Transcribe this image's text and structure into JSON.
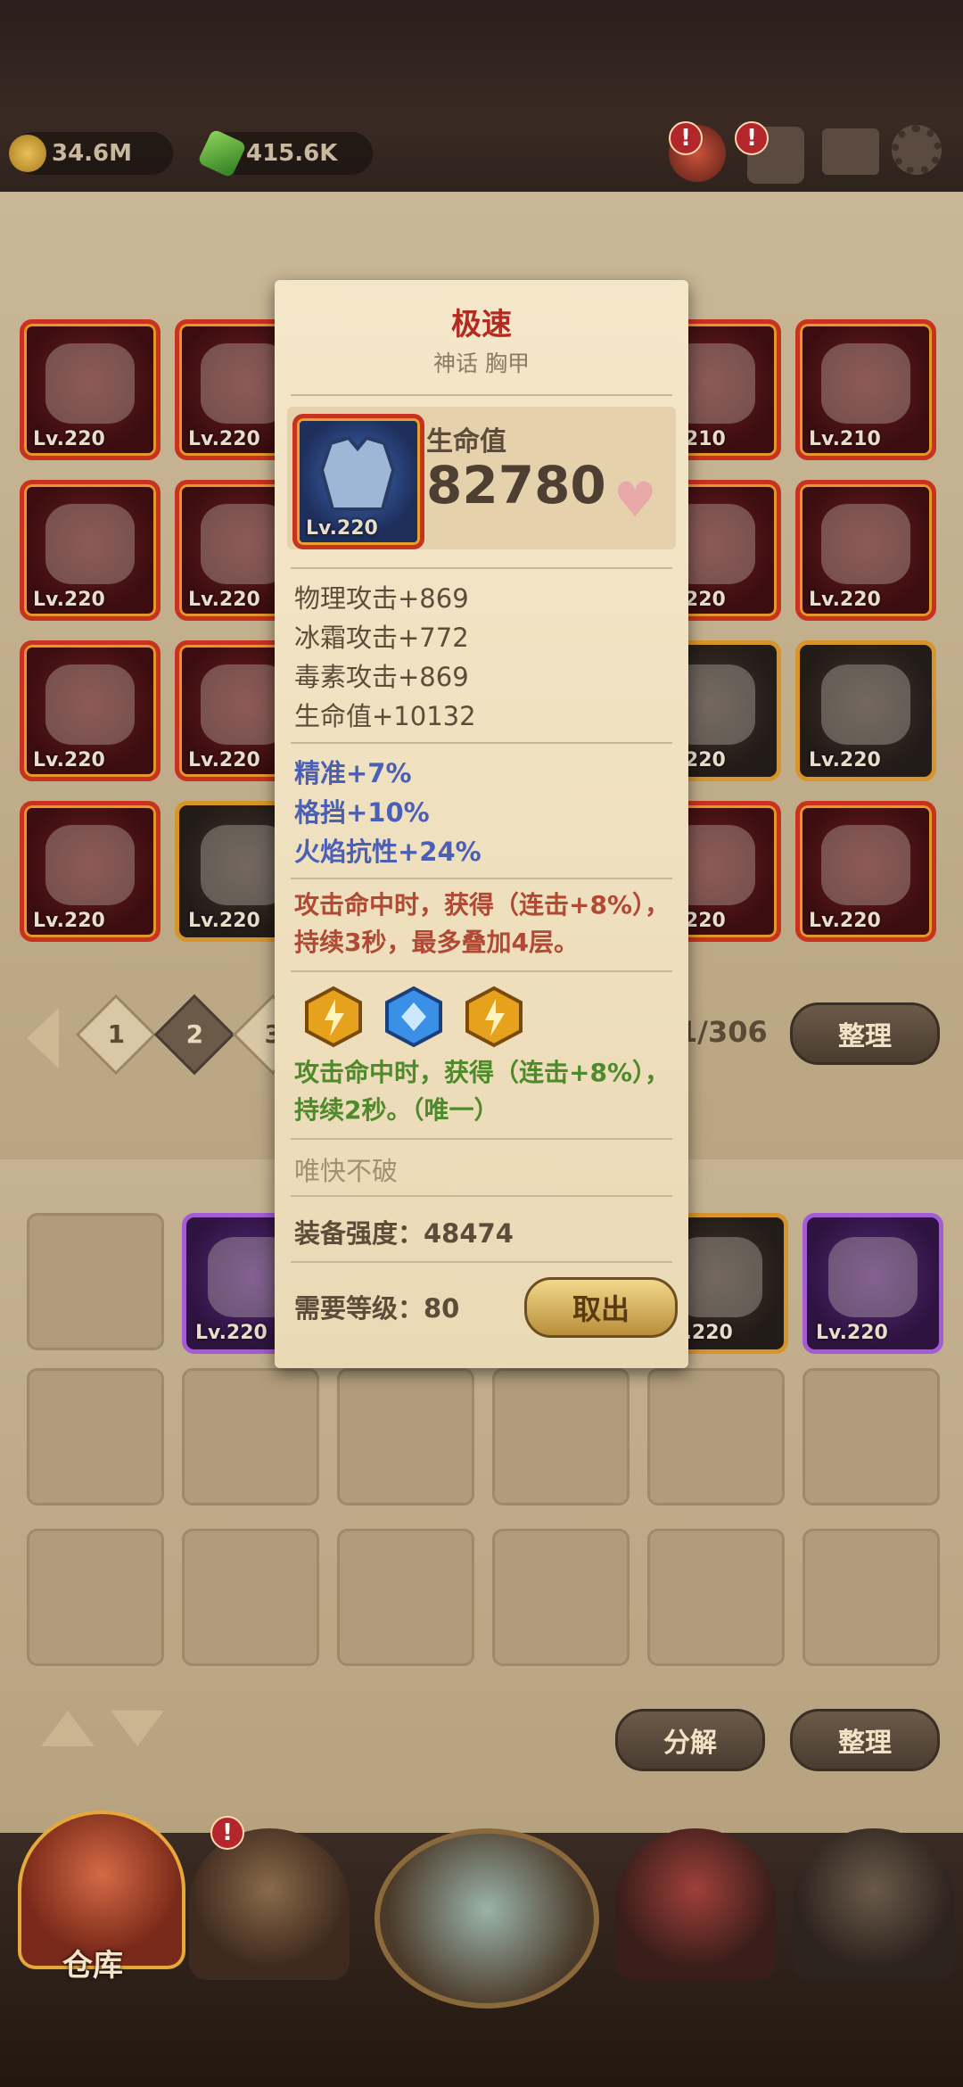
{
  "resources": {
    "gold": "34.6M",
    "gem": "415.6K"
  },
  "top_alerts": [
    "!",
    "!"
  ],
  "inventory": {
    "rows": [
      [
        {
          "lv": "Lv.220",
          "c": "red",
          "icon": "scimitar-icon"
        },
        {
          "lv": "Lv.220",
          "c": "red",
          "icon": "blade-icon"
        },
        {
          "lv": "",
          "c": "red",
          "icon": ""
        },
        {
          "lv": "",
          "c": "red",
          "icon": ""
        },
        {
          "lv": "Lv.210",
          "c": "red",
          "icon": "skull-helmet-icon"
        },
        {
          "lv": "Lv.210",
          "c": "red",
          "icon": "amulet-icon"
        }
      ],
      [
        {
          "lv": "Lv.220",
          "c": "red",
          "icon": "belt-icon"
        },
        {
          "lv": "Lv.220",
          "c": "red",
          "icon": "hood-icon"
        },
        {
          "lv": "",
          "c": "red",
          "icon": ""
        },
        {
          "lv": "",
          "c": "red",
          "icon": ""
        },
        {
          "lv": "Lv.220",
          "c": "red",
          "icon": "staff-icon"
        },
        {
          "lv": "Lv.220",
          "c": "red",
          "icon": "ruby-amulet-icon"
        }
      ],
      [
        {
          "lv": "Lv.220",
          "c": "red",
          "icon": "ring-icon"
        },
        {
          "lv": "Lv.220",
          "c": "red",
          "icon": "ring-icon"
        },
        {
          "lv": "",
          "c": "red",
          "icon": ""
        },
        {
          "lv": "",
          "c": "red",
          "icon": ""
        },
        {
          "lv": "Lv.220",
          "c": "gold",
          "icon": "iron-helmet-icon"
        },
        {
          "lv": "Lv.220",
          "c": "gold",
          "icon": "mask-icon"
        }
      ],
      [
        {
          "lv": "Lv.220",
          "c": "red",
          "icon": "ring-icon"
        },
        {
          "lv": "Lv.220",
          "c": "gold",
          "icon": "armor-icon"
        },
        {
          "lv": "",
          "c": "red",
          "icon": ""
        },
        {
          "lv": "",
          "c": "red",
          "icon": ""
        },
        {
          "lv": "Lv.220",
          "c": "red",
          "icon": "chestplate-icon"
        },
        {
          "lv": "Lv.220",
          "c": "red",
          "icon": "chestplate-icon"
        }
      ]
    ]
  },
  "pager": {
    "p1": "1",
    "p2": "2",
    "p3": "3",
    "count": "1/306",
    "sort_label": "整理"
  },
  "equipped": {
    "row": [
      {
        "lv": "",
        "c": "empty"
      },
      {
        "lv": "Lv.220",
        "c": "purple",
        "icon": "shoulder-icon"
      },
      {
        "lv": "",
        "c": "empty"
      },
      {
        "lv": "",
        "c": "empty"
      },
      {
        "lv": "Lv.220",
        "c": "gold",
        "icon": "helmet-icon"
      },
      {
        "lv": "Lv.220",
        "c": "purple",
        "icon": "sword-stand-icon"
      }
    ]
  },
  "actions": {
    "decompose": "分解",
    "sort": "整理"
  },
  "nav": {
    "warehouse": "仓库",
    "alert": "!"
  },
  "popup": {
    "title": "极速",
    "subtitle": "神话 胸甲",
    "item_lv": "Lv.220",
    "hp_label": "生命值",
    "hp_value": "82780",
    "base_stats": [
      "物理攻击+869",
      "冰霜攻击+772",
      "毒素攻击+869",
      "生命值+10132"
    ],
    "extra_stats": [
      "精准+7%",
      "格挡+10%",
      "火焰抗性+24%"
    ],
    "effect1": "攻击命中时，获得（连击+8%），持续3秒，最多叠加4层。",
    "effect2": "攻击命中时，获得（连击+8%），持续2秒。（唯一）",
    "set_name": "唯快不破",
    "power": "装备强度：48474",
    "req_level": "需要等级：80",
    "take_label": "取出",
    "gems": [
      "lightning-gem-icon",
      "blue-gem-icon",
      "lightning-gem-icon"
    ],
    "colors": {
      "gold_gem": "#e7a21d",
      "blue_gem": "#3a8fe6"
    }
  }
}
